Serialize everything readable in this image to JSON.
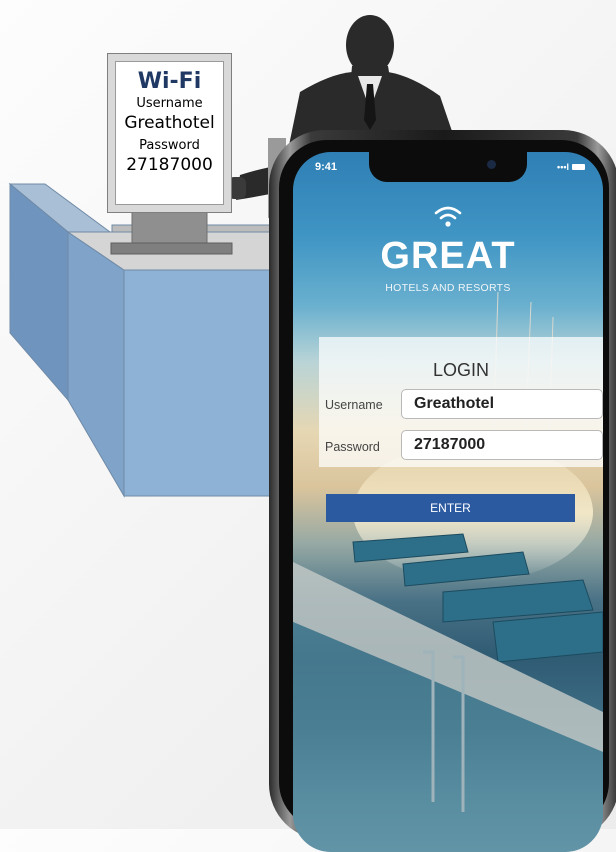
{
  "sign": {
    "title": "Wi-Fi",
    "username_label": "Username",
    "username_value": "Greathotel",
    "password_label": "Password",
    "password_value": "27187000"
  },
  "phone": {
    "status_time": "9:41",
    "signal": "•••l",
    "brand": "GREAT",
    "brand_subtitle": "HOTELS AND RESORTS",
    "login": {
      "title": "LOGIN",
      "username_label": "Username",
      "username_value": "Greathotel",
      "password_label": "Password",
      "password_value": "27187000",
      "enter_label": "ENTER"
    }
  },
  "colors": {
    "sign_title": "#1f3864",
    "enter_button": "#2c5aa0",
    "desk": "#8eb2d6"
  },
  "icons": [
    "wifi-icon",
    "signal-icon",
    "battery-icon",
    "camera-icon"
  ]
}
